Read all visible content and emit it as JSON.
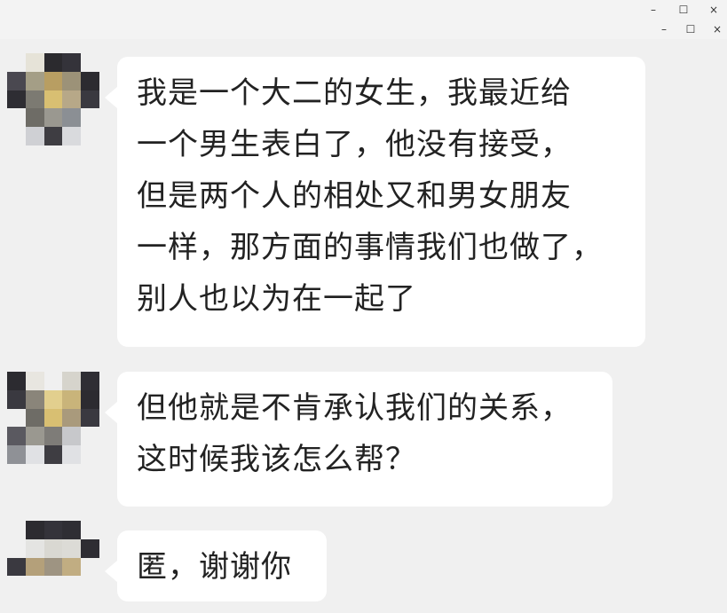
{
  "window_controls": {
    "row1": {
      "minimize": "–",
      "maximize": "☐",
      "close": "×"
    },
    "row2": {
      "minimize": "–",
      "maximize": "☐",
      "close": "×"
    }
  },
  "messages": [
    {
      "sender": "user",
      "lines": [
        "我是一个大二的女生，我最近给",
        "一个男生表白了，他没有接受，",
        "但是两个人的相处又和男女朋友",
        "一样，那方面的事情我们也做了，",
        "别人也以为在一起了"
      ]
    },
    {
      "sender": "user",
      "lines": [
        "但他就是不肯承认我们的关系，",
        "这时候我该怎么帮？"
      ]
    },
    {
      "sender": "user",
      "lines": [
        "匿，谢谢你"
      ]
    }
  ],
  "colors": {
    "background": "#f0f0f0",
    "bubble": "#ffffff",
    "text": "#222222"
  }
}
